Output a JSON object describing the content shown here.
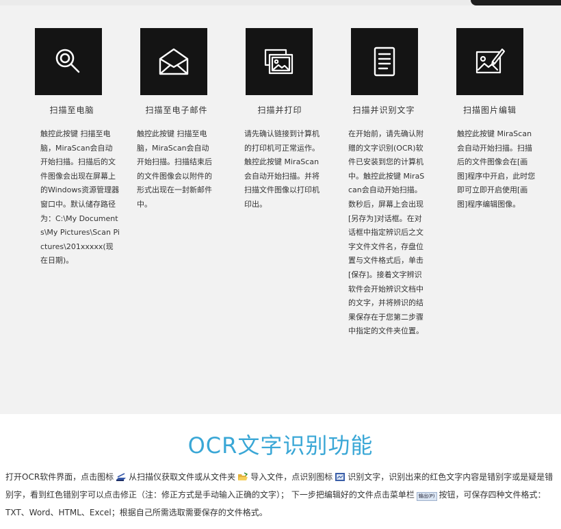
{
  "features": [
    {
      "icon": "search-icon",
      "title": "扫描至电脑",
      "description": "触控此按键 扫描至电脑，MiraScan会自动开始扫描。扫描后的文件图像会出现在屏幕上的Windows资源管理器窗口中。默认储存路径为：C:\\My Documents\\My Pictures\\Scan Pictures\\201xxxxx(现在日期)。"
    },
    {
      "icon": "envelope-icon",
      "title": "扫描至电子邮件",
      "description": "触控此按键 扫描至电脑，MiraScan会自动开始扫描。扫描结束后的文件图像会以附件的形式出现在一封新邮件中。"
    },
    {
      "icon": "print-pictures-icon",
      "title": "扫描并打印",
      "description": "请先确认链接到计算机的打印机可正常运作。触控此按键 MiraScan会自动开始扫描。并将扫描文件图像以打印机印出。"
    },
    {
      "icon": "document-icon",
      "title": "扫描并识别文字",
      "description": "在开始前，请先确认附赠的文字识别(OCR)软件已安装到您的计算机中。触控此按键 MiraScan会自动开始扫描。数秒后，屏幕上会出现 [另存为]对话框。在对话框中指定辨识后之文字文件文件名，存盘位置与文件格式后，单击[保存]。接着文字辨识软件会开始辨识文档中的文字，并将辨识的结果保存在于您第二步骤中指定的文件夹位置。"
    },
    {
      "icon": "image-edit-icon",
      "title": "扫描图片编辑",
      "description": "触控此按键 MiraScan会自动开始扫描。扫描后的文件图像会在[画图]程序中开启，此时您即可立即开启使用[画图]程序编辑图像。"
    }
  ],
  "ocr": {
    "title": "OCR文字识别功能",
    "text_1": "打开OCR软件界面，点击图标",
    "text_2": "从扫描仪获取文件或从文件夹",
    "text_3": "导入文件，点识别图标",
    "text_4": "识别文字，识别出来的红色文字内容是错别字或是疑是错别字，看到红色错别字可以点击修正（注：修正方式是手动输入正确的文字）；  下一步把编辑好的文件点击菜单栏",
    "menu_label": "输出(P)",
    "text_5": "按钮，可保存四种文件格式：TXT、Word、HTML、Excel；根据自己所需选取需要保存的文件格式。",
    "icon_scanner": "scanner-icon",
    "icon_folder": "open-folder-icon",
    "icon_recognize": "recognize-icon"
  },
  "colors": {
    "accent": "#3aa7d6",
    "band_bg": "#f2f2f2",
    "icon_bg": "#141414"
  }
}
